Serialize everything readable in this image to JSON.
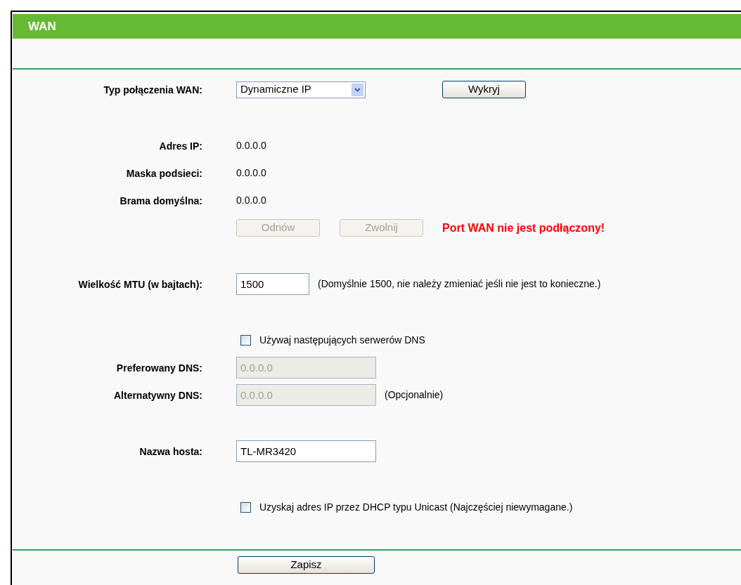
{
  "header": {
    "title": "WAN"
  },
  "sections": [
    {
      "rows": [
        {
          "kind": "select",
          "label": "Typ połączenia WAN:",
          "value": "Dynamiczne IP",
          "buttons": [
            {
              "label": "Wykryj",
              "disabled": false
            }
          ]
        }
      ]
    },
    {
      "rows": [
        {
          "kind": "text",
          "label": "Adres IP:",
          "value": "0.0.0.0"
        },
        {
          "kind": "text",
          "label": "Maska podsieci:",
          "value": "0.0.0.0"
        },
        {
          "kind": "text",
          "label": "Brama domyślna:",
          "value": "0.0.0.0"
        },
        {
          "kind": "buttons",
          "buttons": [
            {
              "label": "Odnów",
              "disabled": true
            },
            {
              "label": "Zwolnij",
              "disabled": true
            }
          ],
          "message": "Port WAN nie jest podłączony!"
        }
      ]
    },
    {
      "rows": [
        {
          "kind": "short_input",
          "label": "Wielkość MTU (w bajtach):",
          "value": "1500",
          "disabled": false,
          "note": "(Domyślnie 1500, nie należy zmieniać jeśli nie jest to konieczne.)"
        }
      ]
    },
    {
      "rows": [
        {
          "kind": "checkbox",
          "text": "Używaj następujących serwerów DNS",
          "checked": false
        },
        {
          "kind": "input",
          "label": "Preferowany DNS:",
          "value": "0.0.0.0",
          "disabled": true
        },
        {
          "kind": "input",
          "label": "Alternatywny DNS:",
          "value": "0.0.0.0",
          "disabled": true,
          "note": "(Opcjonalnie)"
        }
      ]
    },
    {
      "rows": [
        {
          "kind": "input",
          "label": "Nazwa hosta:",
          "value": "TL-MR3420",
          "disabled": false
        }
      ]
    },
    {
      "rows": [
        {
          "kind": "checkbox",
          "text": "Uzyskaj adres IP przez DHCP typu Unicast (Najczęściej niewymagane.)",
          "checked": false
        }
      ]
    }
  ],
  "save_button": {
    "label": "Zapisz"
  }
}
